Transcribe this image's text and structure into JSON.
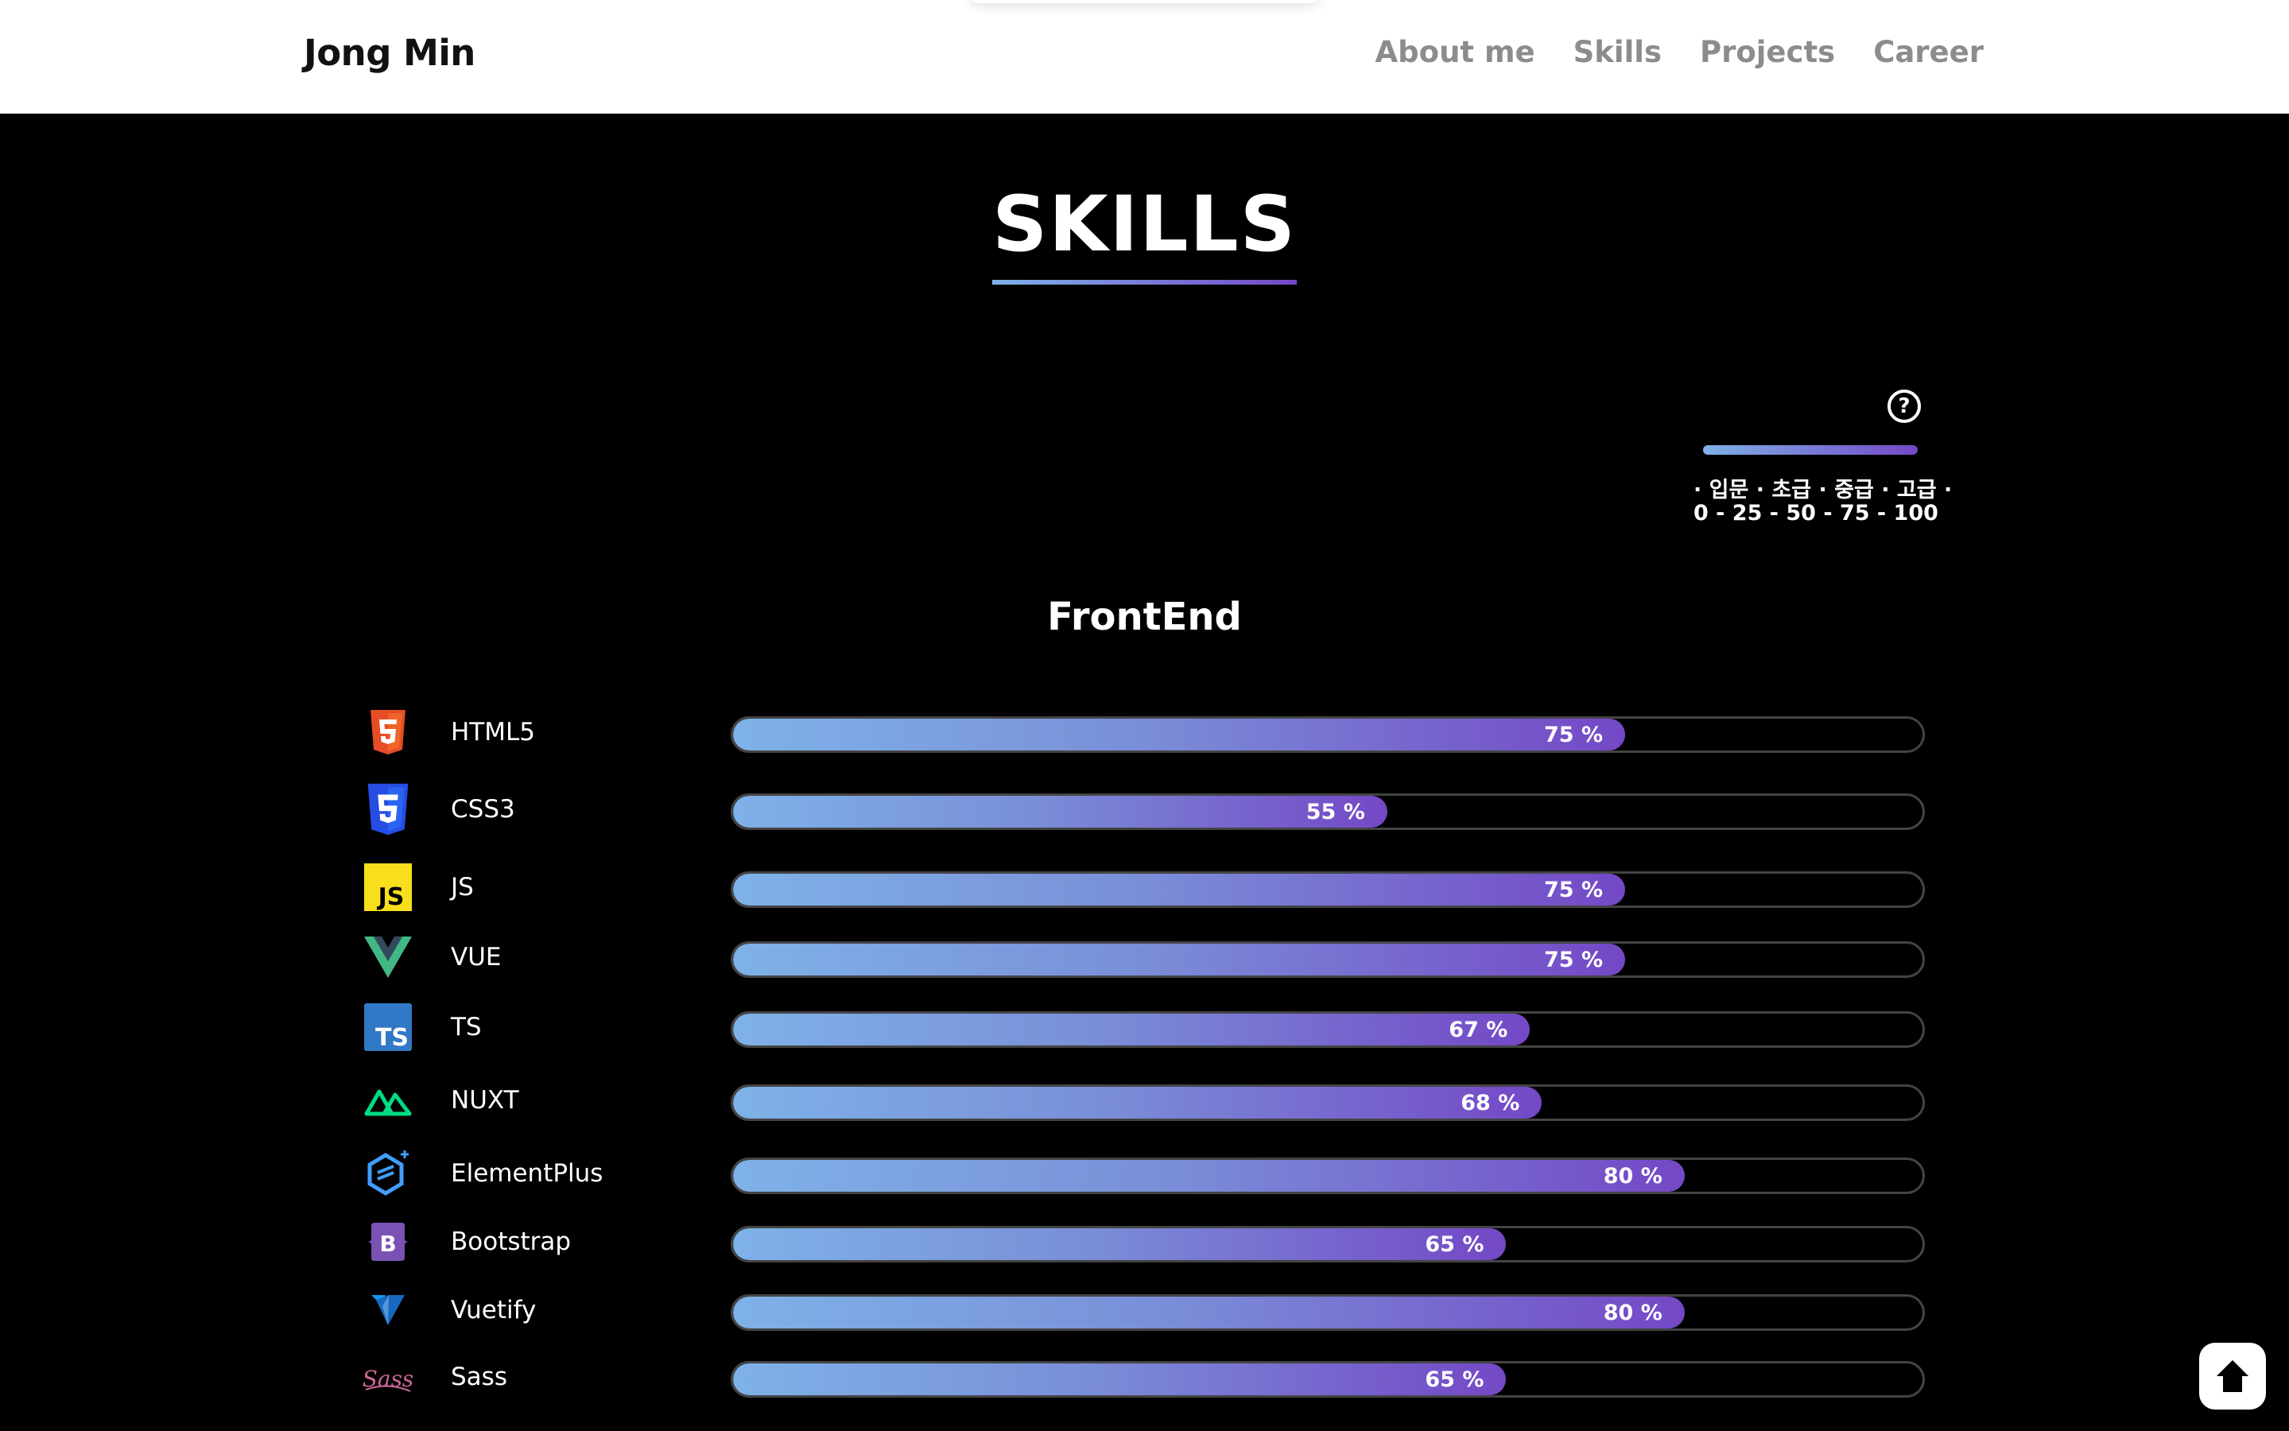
{
  "header": {
    "brand": "Jong Min",
    "nav": [
      {
        "label": "About me"
      },
      {
        "label": "Skills"
      },
      {
        "label": "Projects"
      },
      {
        "label": "Career"
      }
    ]
  },
  "skills": {
    "title": "SKILLS",
    "legend": {
      "icon": "question-circle-icon",
      "levels_text": "· 입문 · 초급 · 중급 · 고급 ·",
      "scale_text": "0 - 25 - 50 - 75 - 100"
    },
    "section_title": "FrontEnd",
    "items": [
      {
        "name": "HTML5",
        "value": 75,
        "label": "75 %",
        "icon": "html5-icon"
      },
      {
        "name": "CSS3",
        "value": 55,
        "label": "55 %",
        "icon": "css3-icon"
      },
      {
        "name": "JS",
        "value": 75,
        "label": "75 %",
        "icon": "javascript-icon"
      },
      {
        "name": "VUE",
        "value": 75,
        "label": "75 %",
        "icon": "vue-icon"
      },
      {
        "name": "TS",
        "value": 67,
        "label": "67 %",
        "icon": "typescript-icon"
      },
      {
        "name": "NUXT",
        "value": 68,
        "label": "68 %",
        "icon": "nuxt-icon"
      },
      {
        "name": "ElementPlus",
        "value": 80,
        "label": "80 %",
        "icon": "elementplus-icon"
      },
      {
        "name": "Bootstrap",
        "value": 65,
        "label": "65 %",
        "icon": "bootstrap-icon"
      },
      {
        "name": "Vuetify",
        "value": 80,
        "label": "80 %",
        "icon": "vuetify-icon"
      },
      {
        "name": "Sass",
        "value": 65,
        "label": "65 %",
        "icon": "sass-icon"
      }
    ]
  },
  "colors": {
    "gradient_start": "#7eb2e8",
    "gradient_end": "#7448c6",
    "background": "#000000",
    "header_bg": "#ffffff",
    "nav_text": "#8c8c8c"
  },
  "scroll_top": {
    "icon": "arrow-up-icon"
  }
}
